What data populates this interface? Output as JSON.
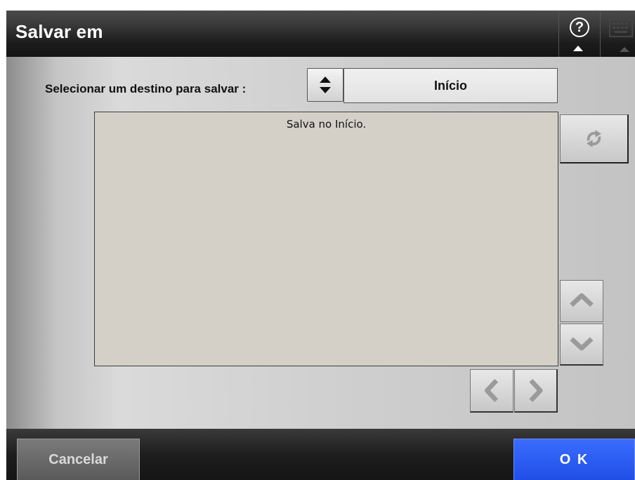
{
  "header": {
    "title": "Salvar em",
    "help_icon": "help-icon",
    "keyboard_icon": "keyboard-icon"
  },
  "destination": {
    "label": "Selecionar um destino para salvar :",
    "toggle_icon": "up-down-arrows-icon",
    "selected_value": "Início"
  },
  "list": {
    "message": "Salva no Início."
  },
  "side_buttons": {
    "refresh_icon": "refresh-icon",
    "scroll_up_icon": "chevron-up-icon",
    "scroll_down_icon": "chevron-down-icon",
    "scroll_left_icon": "chevron-left-icon",
    "scroll_right_icon": "chevron-right-icon"
  },
  "footer": {
    "cancel_label": "Cancelar",
    "ok_label": "O K"
  },
  "colors": {
    "ok_button": "#2a5cff",
    "titlebar": "#1c1c1c",
    "list_background": "#d4d0c8"
  }
}
